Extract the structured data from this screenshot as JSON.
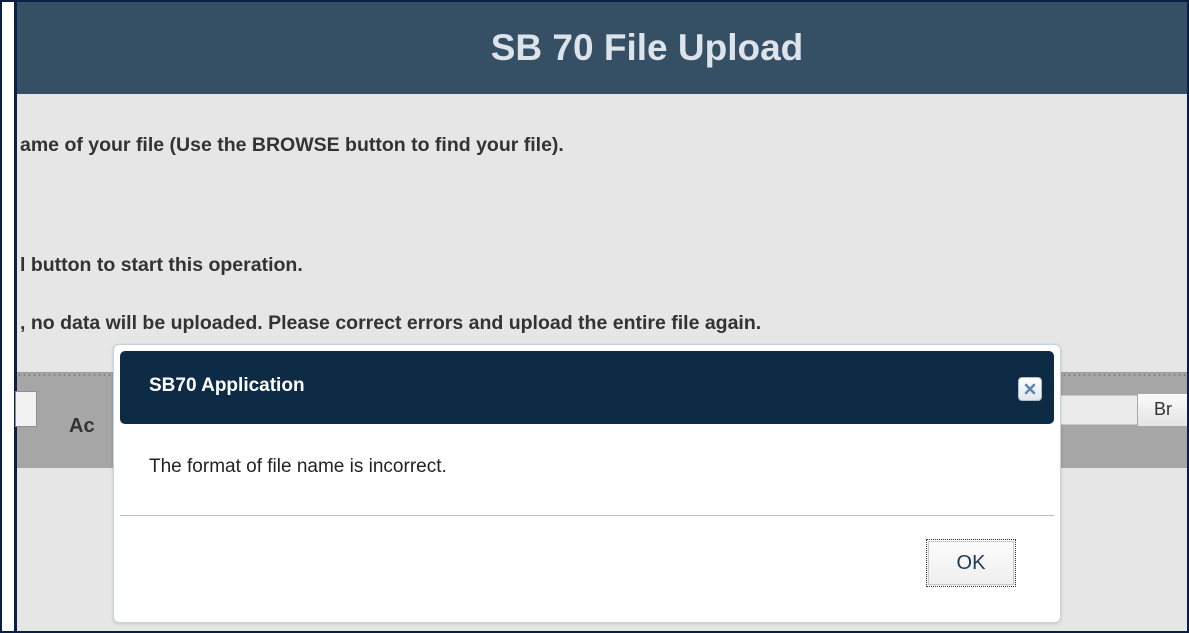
{
  "page": {
    "title": "SB 70 File Upload"
  },
  "instructions": {
    "line1": "ame of your file (Use the BROWSE button to find your file).",
    "line2": "l button to start this operation.",
    "line3": ", no data will be uploaded. Please correct errors and upload the entire file again."
  },
  "form": {
    "action_label": "Ac",
    "browse_label": "Br"
  },
  "dialog": {
    "title": "SB70 Application",
    "message": "The format of file name is incorrect.",
    "ok_label": "OK",
    "close_icon": "close-icon"
  },
  "colors": {
    "header_bg": "#355064",
    "dialog_titlebar_bg": "#0d2b45",
    "page_bg": "#e6e6e6"
  }
}
